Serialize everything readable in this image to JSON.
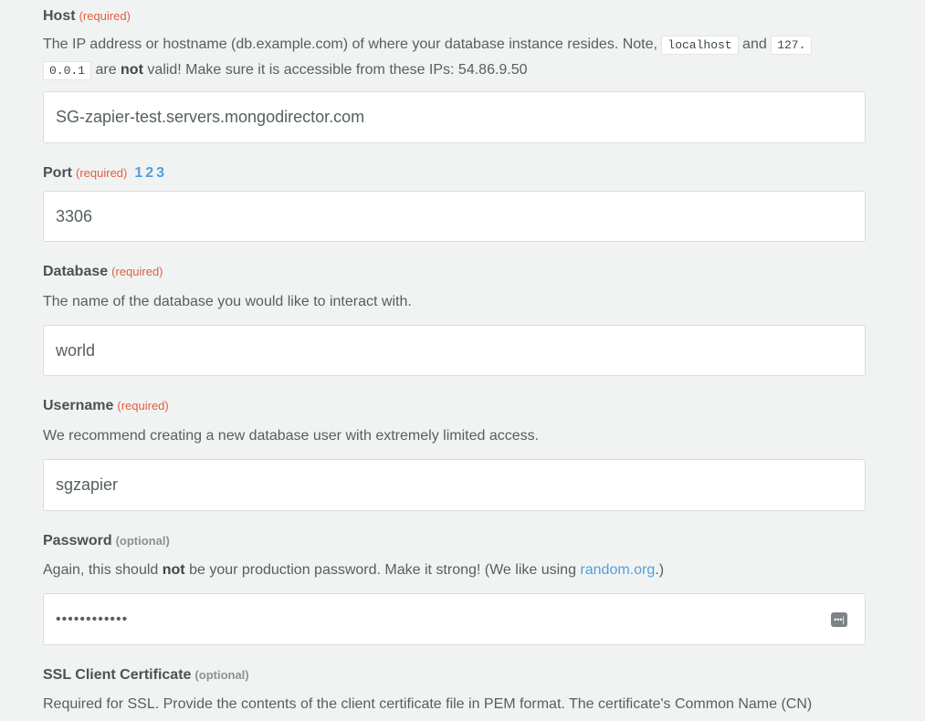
{
  "host": {
    "label": "Host",
    "badge": "(required)",
    "help_1": "The IP address or hostname (db.example.com) of where your database instance resides. Note, ",
    "code_1": "localhost",
    "help_and": " and ",
    "code_2a": "127.",
    "code_2b": "0.0.1",
    "help_2": " are ",
    "help_not": "not",
    "help_3": " valid! Make sure it is accessible from these IPs: 54.86.9.50",
    "value": "SG-zapier-test.servers.mongodirector.com"
  },
  "port": {
    "label": "Port",
    "badge": "(required)",
    "links": [
      "1",
      "2",
      "3"
    ],
    "value": "3306"
  },
  "database": {
    "label": "Database",
    "badge": "(required)",
    "help": "The name of the database you would like to interact with.",
    "value": "world"
  },
  "username": {
    "label": "Username",
    "badge": "(required)",
    "help": "We recommend creating a new database user with extremely limited access.",
    "value": "sgzapier"
  },
  "password": {
    "label": "Password",
    "badge": "(optional)",
    "help_1": "Again, this should ",
    "help_not": "not",
    "help_2": " be your production password. Make it strong! (We like using ",
    "help_link": "random.org",
    "help_3": ".)",
    "value": "••••••••••••",
    "icon": "password-manager-icon",
    "icon_glyph": "•••|"
  },
  "ssl_cert": {
    "label": "SSL Client Certificate",
    "badge": "(optional)",
    "help": "Required for SSL. Provide the contents of the client certificate file in PEM format. The certificate's Common Name (CN)"
  }
}
